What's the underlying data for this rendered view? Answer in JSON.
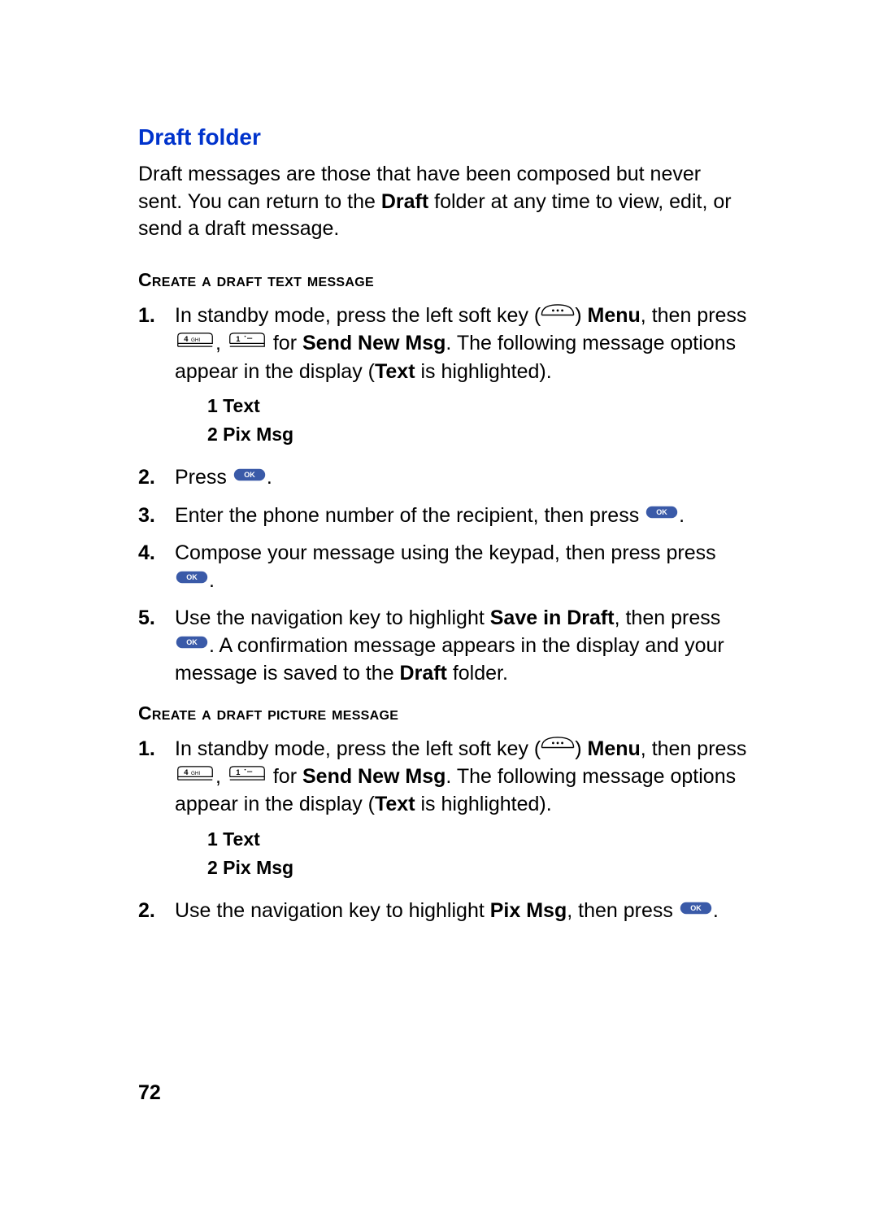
{
  "title": "Draft folder",
  "intro_pre": "Draft messages are those that have been composed but never sent. You can return to the ",
  "intro_bold": "Draft",
  "intro_post": " folder at any time to view, edit, or send a draft message.",
  "section1_heading": "Create a draft text message",
  "sec1_step1_a": "In standby mode, press the left soft key (",
  "sec1_step1_b": ") ",
  "sec1_step1_menu": "Menu",
  "sec1_step1_c": ", then press ",
  "sec1_step1_d": ", ",
  "sec1_step1_e": " for ",
  "sec1_step1_send": "Send New Msg",
  "sec1_step1_f": ". The following message options appear in the display (",
  "sec1_step1_text": "Text",
  "sec1_step1_g": " is highlighted).",
  "optlist_line1": "1 Text",
  "optlist_line2": "2 Pix Msg",
  "sec1_step2_a": "Press ",
  "sec1_step2_b": ".",
  "sec1_step3_a": "Enter the phone number of the recipient, then press ",
  "sec1_step3_b": ".",
  "sec1_step4_a": "Compose your message using the keypad, then press press ",
  "sec1_step4_b": ".",
  "sec1_step5_a": "Use the navigation key to highlight ",
  "sec1_step5_save": "Save in Draft",
  "sec1_step5_b": ", then press ",
  "sec1_step5_c": ". A confirmation message appears in the display and your message is saved to the ",
  "sec1_step5_draft": "Draft",
  "sec1_step5_d": " folder.",
  "section2_heading": "Create a draft picture message",
  "sec2_step1_a": "In standby mode, press the left soft key (",
  "sec2_step1_b": ") ",
  "sec2_step1_menu": "Menu",
  "sec2_step1_c": ", then press ",
  "sec2_step1_d": ", ",
  "sec2_step1_e": " for ",
  "sec2_step1_send": "Send New Msg",
  "sec2_step1_f": ". The following message options appear in the display (",
  "sec2_step1_text": "Text",
  "sec2_step1_g": " is highlighted).",
  "sec2_step2_a": "Use the navigation key to highlight ",
  "sec2_step2_pix": "Pix Msg",
  "sec2_step2_b": ", then press ",
  "sec2_step2_c": ".",
  "num1": "1.",
  "num2": "2.",
  "num3": "3.",
  "num4": "4.",
  "num5": "5.",
  "page_number": "72",
  "key4_label": "4 GHI",
  "key1_label": "1",
  "ok_label": "OK"
}
